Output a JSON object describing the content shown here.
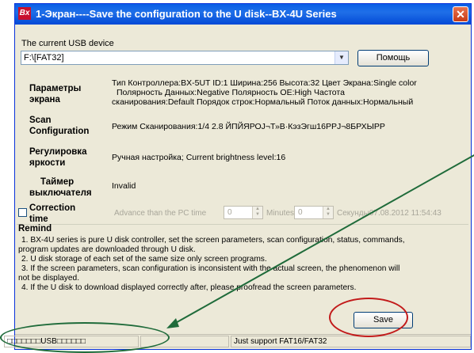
{
  "window": {
    "icon_text": "Bx",
    "title": "1-Экран----Save the configuration to the U disk--BX-4U Series",
    "close_glyph": "✕"
  },
  "usb": {
    "label": "The current USB device",
    "selected": "F:\\[FAT32]",
    "help_button": "Помощь"
  },
  "params": {
    "title_line1": "Параметры",
    "title_line2": "экрана",
    "line1": "Тип Контроллера:BX-5UT  ID:1  Ширина:256  Высота:32  Цвет Экрана:Single color",
    "line2": "Полярность Данных:Negative  Полярность OE:High  Частота",
    "line3": "сканирования:Default  Порядок строк:Нормальный  Поток данных:Нормальный"
  },
  "scan": {
    "title_line1": "Scan",
    "title_line2": "Configuration",
    "value": "Режим Сканирования:1/4    2.8 ЙПЙЯРОJ¬Т»В·КэзЭгш16РРJ¬8БРХЫРР"
  },
  "brightness": {
    "title_line1": "Регулировка",
    "title_line2": "яркости",
    "value": "Ручная настройка;  Current brightness level:16"
  },
  "timer": {
    "title_line1": "Таймер",
    "title_line2": "выключателя",
    "value": "Invalid"
  },
  "correction": {
    "title_line1": "Correction",
    "title_line2": "time",
    "advance_label": "Advance than the PC time",
    "minutes_value": "0",
    "minutes_label": "Minutes",
    "seconds_value": "0",
    "seconds_label": "Секунды07.08.2012 11:54:43"
  },
  "remind": {
    "title": "Remind",
    "lines": [
      "1. BX-4U series is pure U disk controller, set the screen parameters, scan configuration, status, commands,",
      "program updates are downloaded through U disk.",
      "2. U disk storage of each set of the same size only screen programs.",
      "3. If the screen parameters, scan configuration is inconsistent with the actual screen, the phenomenon will",
      "not be displayed.",
      "4. If the U disk to download displayed correctly after, please proofread the screen parameters."
    ]
  },
  "save_button": "Save",
  "status": {
    "left": "□□□□□□□USB□□□□□□",
    "middle": "",
    "right": "Just support FAT16/FAT32"
  },
  "colors": {
    "title_bar": "#0a5ee6",
    "dialog_bg": "#ece9d8",
    "annotation_red": "#c21a1a",
    "annotation_green": "#1f6b3a",
    "arrow_green": "#1f6b3a"
  }
}
